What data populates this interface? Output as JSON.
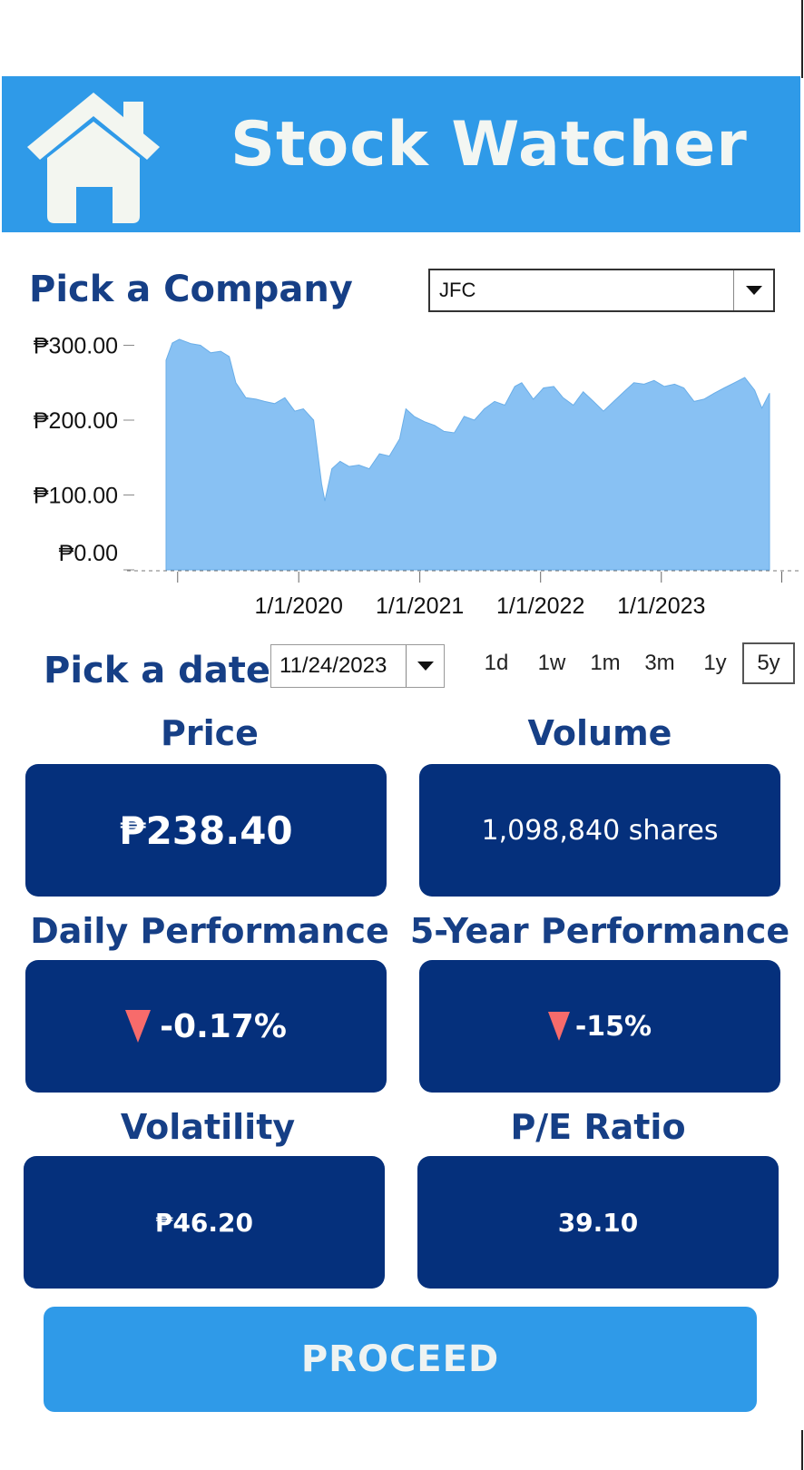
{
  "header": {
    "title": "Stock Watcher",
    "home_icon": "home-icon"
  },
  "company": {
    "label": "Pick a Company",
    "selected": "JFC"
  },
  "date": {
    "label": "Pick a date",
    "selected": "11/24/2023"
  },
  "ranges": {
    "options": [
      "1d",
      "1w",
      "1m",
      "3m",
      "1y",
      "5y"
    ],
    "active": "5y"
  },
  "metrics": {
    "price": {
      "label": "Price",
      "value": "₱238.40"
    },
    "volume": {
      "label": "Volume",
      "value": "1,098,840 shares"
    },
    "daily": {
      "label": "Daily Performance",
      "value": "-0.17%",
      "direction": "down"
    },
    "five_year": {
      "label": "5-Year Performance",
      "value": "-15%",
      "direction": "down"
    },
    "volatility": {
      "label": "Volatility",
      "value": "₱46.20"
    },
    "pe": {
      "label": "P/E Ratio",
      "value": "39.10"
    }
  },
  "proceed_label": "PROCEED",
  "colors": {
    "brand": "#2f9ae8",
    "card": "#05307c",
    "label": "#163f86",
    "down": "#f76b6b",
    "area": "#88c1f3"
  },
  "chart_data": {
    "type": "area",
    "x_start": "2018-11-26",
    "x_end": "2023-11-24",
    "x_ticks": [
      "1/1/2020",
      "1/1/2021",
      "1/1/2022",
      "1/1/2023"
    ],
    "y_ticks": [
      "₱0.00",
      "₱100.00",
      "₱200.00",
      "₱300.00"
    ],
    "ylim": [
      0,
      320
    ],
    "x": [
      "2018-11-26",
      "2018-12-15",
      "2019-01-05",
      "2019-02-10",
      "2019-03-10",
      "2019-04-10",
      "2019-05-10",
      "2019-06-05",
      "2019-06-25",
      "2019-07-25",
      "2019-08-25",
      "2019-09-20",
      "2019-10-20",
      "2019-11-20",
      "2019-12-20",
      "2020-01-15",
      "2020-02-15",
      "2020-03-10",
      "2020-03-20",
      "2020-04-10",
      "2020-05-05",
      "2020-06-01",
      "2020-07-01",
      "2020-08-01",
      "2020-09-01",
      "2020-10-01",
      "2020-11-01",
      "2020-11-20",
      "2020-12-15",
      "2021-01-15",
      "2021-02-15",
      "2021-03-15",
      "2021-04-15",
      "2021-05-15",
      "2021-06-15",
      "2021-07-15",
      "2021-08-15",
      "2021-09-15",
      "2021-10-15",
      "2021-11-05",
      "2021-12-10",
      "2022-01-10",
      "2022-02-10",
      "2022-03-10",
      "2022-04-10",
      "2022-05-10",
      "2022-06-10",
      "2022-07-10",
      "2022-08-10",
      "2022-09-10",
      "2022-10-10",
      "2022-11-10",
      "2022-12-10",
      "2023-01-10",
      "2023-02-10",
      "2023-03-10",
      "2023-04-10",
      "2023-05-10",
      "2023-06-10",
      "2023-07-10",
      "2023-08-10",
      "2023-09-10",
      "2023-10-10",
      "2023-11-01",
      "2023-11-24"
    ],
    "y": [
      280,
      303,
      308,
      302,
      300,
      290,
      292,
      285,
      250,
      230,
      228,
      225,
      222,
      230,
      212,
      215,
      200,
      115,
      92,
      135,
      145,
      138,
      140,
      135,
      155,
      152,
      175,
      215,
      205,
      198,
      193,
      185,
      183,
      205,
      200,
      215,
      225,
      220,
      245,
      250,
      228,
      243,
      245,
      230,
      220,
      238,
      225,
      212,
      225,
      238,
      250,
      248,
      253,
      245,
      248,
      243,
      225,
      228,
      236,
      243,
      250,
      257,
      240,
      216,
      236
    ]
  }
}
